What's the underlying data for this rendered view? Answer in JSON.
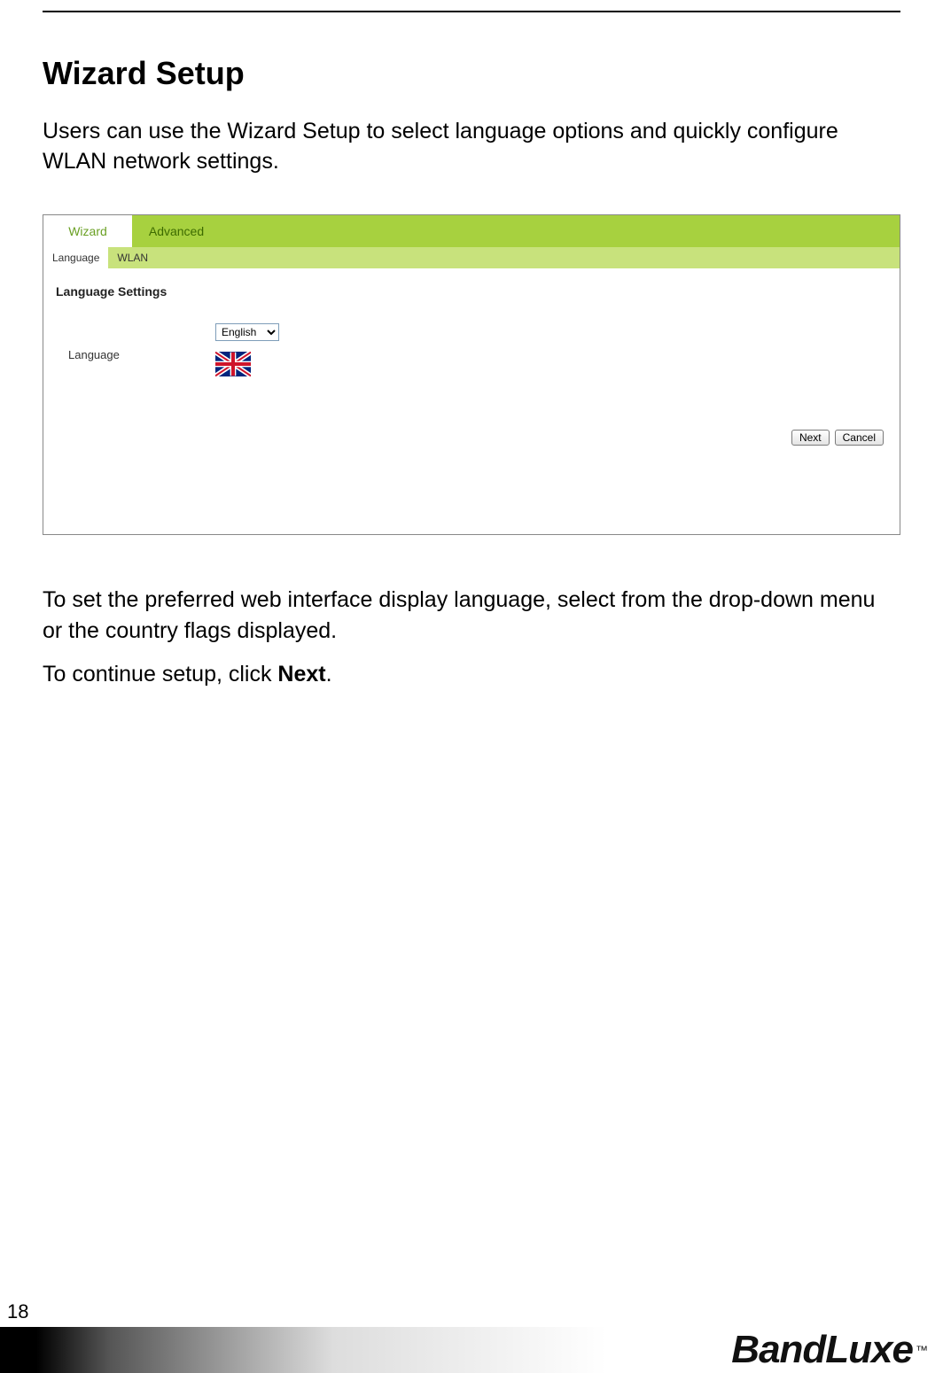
{
  "title": "Wizard Setup",
  "intro": "Users can use the Wizard Setup to select language options and quickly configure WLAN network settings.",
  "ui": {
    "tabs": {
      "wizard": "Wizard",
      "advanced": "Advanced"
    },
    "subtabs": {
      "language": "Language",
      "wlan": "WLAN"
    },
    "heading": "Language Settings",
    "language_label": "Language",
    "language_value": "English",
    "flag": "uk-flag",
    "buttons": {
      "next": "Next",
      "cancel": "Cancel"
    }
  },
  "followup1": "To set the preferred web interface display language, select from the drop-down menu or the country flags displayed.",
  "followup2_prefix": "To continue setup, click ",
  "followup2_bold": "Next",
  "followup2_suffix": ".",
  "page_number": "18",
  "brand": "BandLuxe",
  "brand_tm": "™"
}
